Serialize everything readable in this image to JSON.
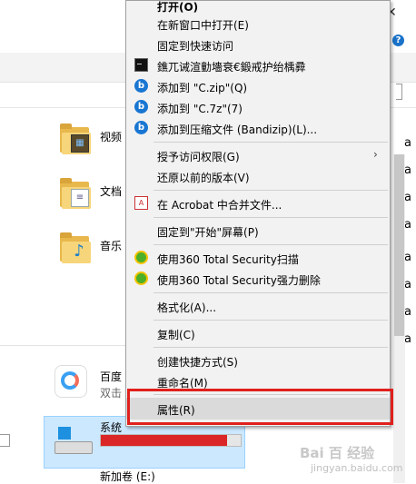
{
  "menu": {
    "items": [
      {
        "label": "打开(O)",
        "icon": "none"
      },
      {
        "label": "在新窗口中打开(E)",
        "icon": "none"
      },
      {
        "label": "固定到快速访问",
        "icon": "none"
      },
      {
        "label": "鐎兀诫渲勭墻衰€鍛戒护绐楀彛",
        "icon": "cmd-icon"
      },
      {
        "label": "添加到 \"C.zip\"(Q)",
        "icon": "bandizip-icon"
      },
      {
        "label": "添加到 \"C.7z\"(7)",
        "icon": "bandizip-icon"
      },
      {
        "label": "添加到压缩文件 (Bandizip)(L)...",
        "icon": "bandizip-icon"
      },
      {
        "label": "授予访问权限(G)",
        "icon": "none",
        "submenu": true
      },
      {
        "label": "还原以前的版本(V)",
        "icon": "none"
      },
      {
        "label": "在 Acrobat 中合并文件...",
        "icon": "acrobat-icon"
      },
      {
        "label": "固定到\"开始\"屏幕(P)",
        "icon": "none"
      },
      {
        "label": "使用360 Total Security扫描",
        "icon": "360-icon"
      },
      {
        "label": "使用360 Total Security强力删除",
        "icon": "360-icon"
      },
      {
        "label": "格式化(A)...",
        "icon": "none"
      },
      {
        "label": "复制(C)",
        "icon": "none"
      },
      {
        "label": "创建快捷方式(S)",
        "icon": "none"
      },
      {
        "label": "重命名(M)",
        "icon": "none"
      },
      {
        "label": "属性(R)",
        "icon": "none"
      }
    ]
  },
  "explorer": {
    "folders": [
      {
        "label": "视频"
      },
      {
        "label": "文档"
      },
      {
        "label": "音乐"
      }
    ],
    "app_label": "百度",
    "app_sub": "双击",
    "drive_label": "系统",
    "drive_usage": 0.9,
    "new_volume": "新加卷 (E:)",
    "right_fragments": [
      "a",
      "a",
      "a",
      "a",
      "a",
      "a",
      "a",
      "a"
    ]
  },
  "watermark": {
    "main": "Bai 百 经验",
    "sub": "jingyan.baidu.com"
  },
  "colors": {
    "accent_red": "#e0201c",
    "selection": "#cce8ff",
    "drive_bar": "#da2626"
  }
}
